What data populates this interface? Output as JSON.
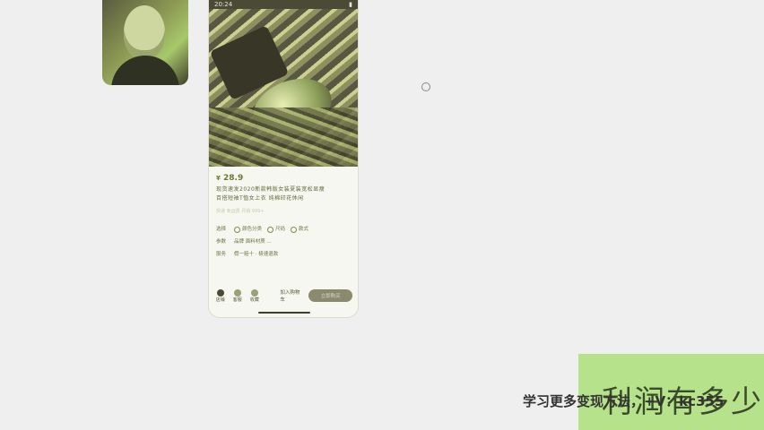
{
  "phone": {
    "status_time": "20:24",
    "price_symbol": "¥",
    "price": "28.9",
    "desc_line1": "现货速发2020新款韩版女装夏装宽松显瘦",
    "desc_line2": "百搭短袖T恤女上衣  纯棉印花休闲",
    "muted_line": "快递 免运费   月销 999+",
    "attrs": [
      {
        "key": "选择",
        "tags": [
          "颜色分类",
          "尺码",
          "款式"
        ]
      },
      {
        "key": "参数",
        "value": "品牌 面料材质 ..."
      },
      {
        "key": "服务",
        "value": "假一赔十 · 极速退款"
      }
    ],
    "actions": [
      {
        "label": "店铺"
      },
      {
        "label": "客服"
      },
      {
        "label": "收藏"
      }
    ],
    "contact_label": "加入购物车",
    "buy_label": "立即购买"
  },
  "overlay": {
    "promo_text": "学习更多变现方法，+V：kc355",
    "profit_text": "利润有多少"
  }
}
